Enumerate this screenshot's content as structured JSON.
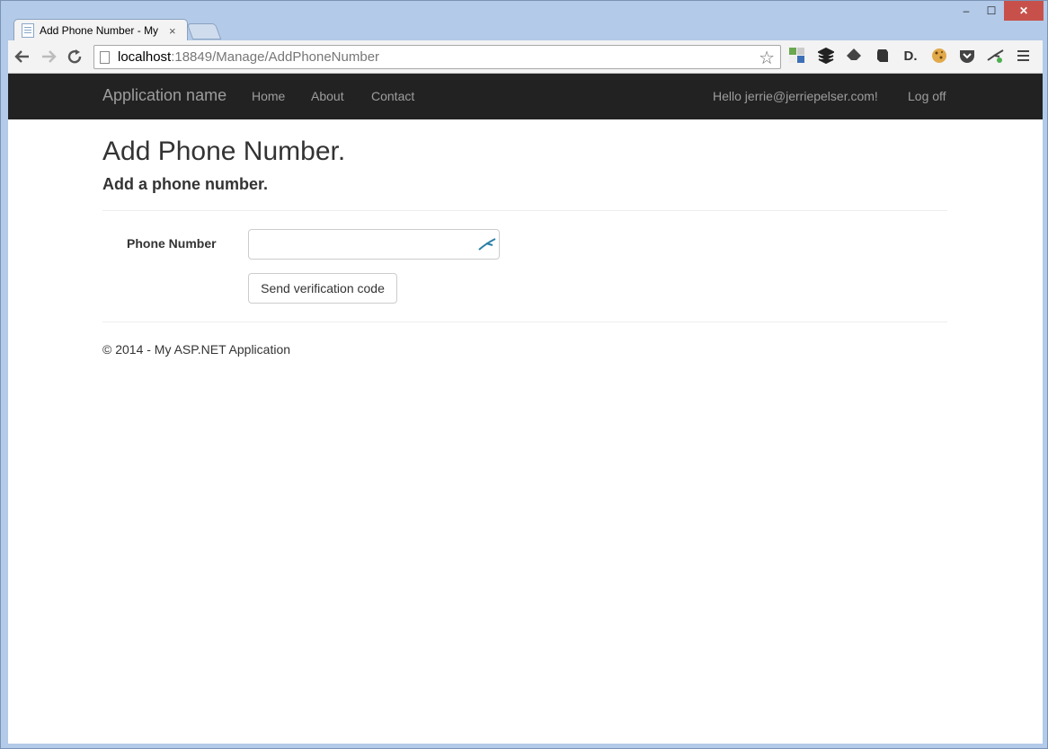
{
  "browser": {
    "tab_title": "Add Phone Number - My",
    "tab_close": "×",
    "url_host": "localhost",
    "url_rest": ":18849/Manage/AddPhoneNumber",
    "window_controls": {
      "minimize": "–",
      "maximize": "☐",
      "close": "✕"
    },
    "extensions": [
      "color-squares-icon",
      "buffer-icon",
      "feedly-icon",
      "evernote-icon",
      "d-icon",
      "cookie-icon",
      "pocket-icon",
      "lastpass-icon",
      "menu-icon"
    ],
    "ext_d_label": "D."
  },
  "navbar": {
    "brand": "Application name",
    "links": {
      "home": "Home",
      "about": "About",
      "contact": "Contact"
    },
    "hello": "Hello jerrie@jerriepelser.com!",
    "logoff": "Log off"
  },
  "main": {
    "title": "Add Phone Number.",
    "subtitle": "Add a phone number.",
    "phone_label": "Phone Number",
    "phone_value": "",
    "send_button": "Send verification code"
  },
  "footer": {
    "text": "© 2014 - My ASP.NET Application"
  },
  "colors": {
    "navbar_bg": "#222222",
    "navbar_text": "#9d9d9d",
    "close_button": "#c7514a"
  }
}
